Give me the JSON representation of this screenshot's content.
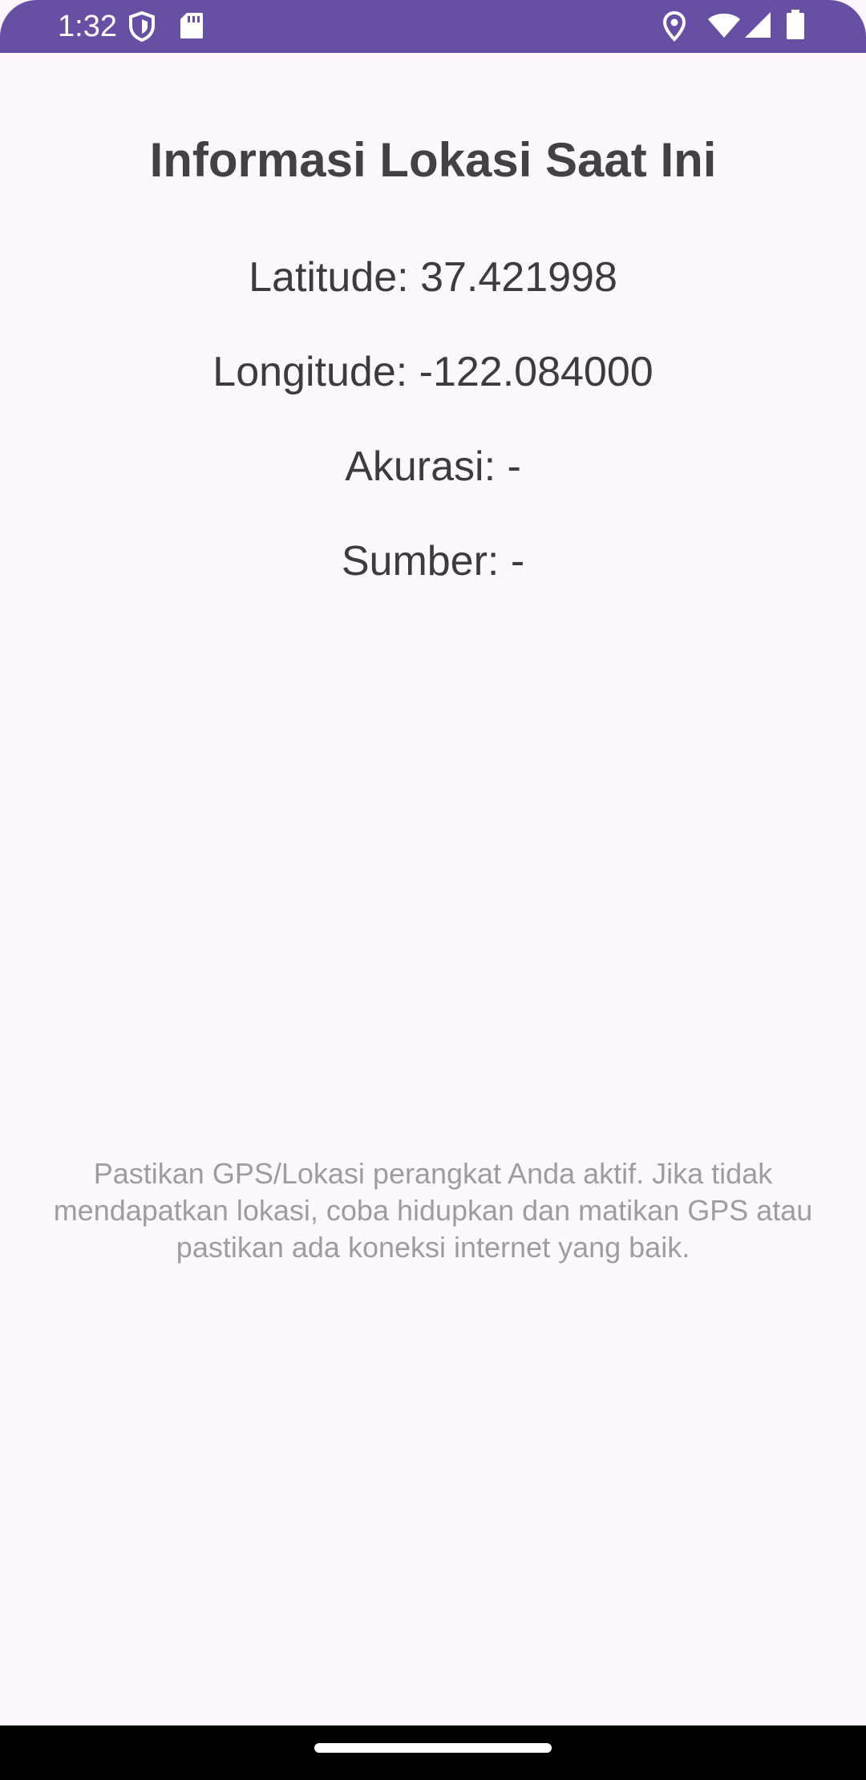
{
  "status_bar": {
    "time": "1:32",
    "icons": [
      "shield-icon",
      "sd-card-icon",
      "location-pin-icon",
      "wifi-icon",
      "signal-icon",
      "battery-icon"
    ],
    "background": "#6750A4"
  },
  "screen": {
    "title": "Informasi Lokasi Saat Ini",
    "latitude": "Latitude: 37.421998",
    "longitude": "Longitude: -122.084000",
    "accuracy": "Akurasi: -",
    "source": "Sumber: -",
    "hint": "Pastikan GPS/Lokasi perangkat Anda aktif. Jika tidak mendapatkan lokasi, coba hidupkan dan matikan GPS atau pastikan ada koneksi internet yang baik."
  },
  "colors": {
    "background": "#FEF7FF",
    "accent": "#6750A4",
    "text_primary": "#444046",
    "text_hint": "#A09BA3"
  }
}
